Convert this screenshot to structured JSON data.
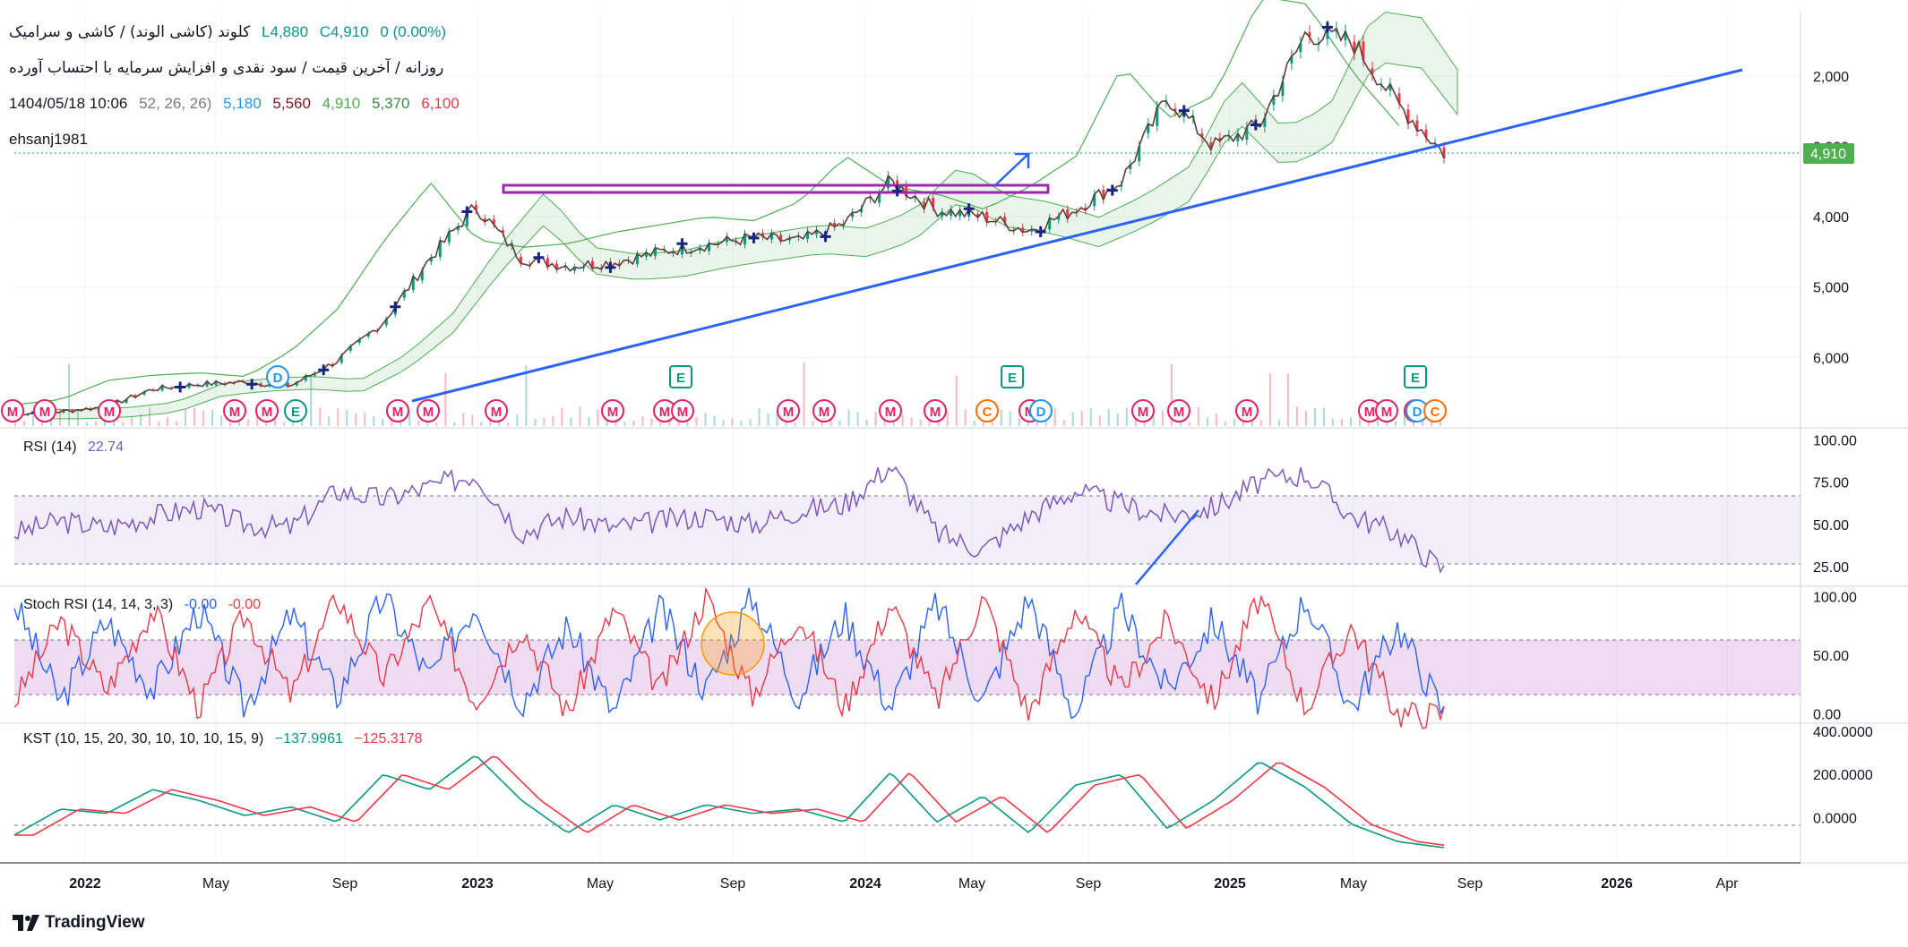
{
  "header": {
    "symbol_line": "کلوند (کاشی الوند) / کاشی و سرامیک",
    "ohlc_l": "L4,880",
    "ohlc_c": "C4,910",
    "change": "0 (0.00%)",
    "subtitle": "روزانه / آخرین قیمت / سود نقدی و افزایش سرمایه با احتساب آورده",
    "datetime": "1404/05/18 10:06",
    "author": "ehsanj1981",
    "ichimoku_params": "52, 26, 26)",
    "ichimoku_values": [
      "5,180",
      "5,560",
      "4,910",
      "5,370",
      "6,100"
    ],
    "ichimoku_colors": [
      "#2196f3",
      "#801922",
      "#4caf50",
      "#388e3c",
      "#f23645"
    ]
  },
  "price_axis": {
    "ticks": [
      "6,000",
      "5,000",
      "4,000",
      "3,000",
      "2,000"
    ],
    "last_price": "4,910"
  },
  "time_axis": {
    "labels": [
      "2022",
      "May",
      "Sep",
      "2023",
      "May",
      "Sep",
      "2024",
      "May",
      "Sep",
      "2025",
      "May",
      "Sep",
      "2026",
      "Apr"
    ]
  },
  "events": {
    "markers": [
      "M",
      "M",
      "M",
      "M",
      "M",
      "E",
      "M",
      "M",
      "M",
      "M",
      "M",
      "M",
      "M",
      "M",
      "M",
      "M",
      "C",
      "M",
      "D",
      "M",
      "M",
      "M",
      "M",
      "M",
      "M",
      "D",
      "C"
    ],
    "top_markers": [
      "D",
      "E",
      "E",
      "E"
    ]
  },
  "rsi": {
    "title": "RSI (14)",
    "value": "22.74",
    "ticks": [
      "100.00",
      "75.00",
      "50.00",
      "25.00"
    ]
  },
  "stoch": {
    "title": "Stoch RSI (14, 14, 3, 3)",
    "k": "-0.00",
    "d": "-0.00",
    "ticks": [
      "100.00",
      "50.00",
      "0.00"
    ]
  },
  "kst": {
    "title": "KST (10, 15, 20, 30, 10, 10, 10, 15, 9)",
    "v1": "−137.9961",
    "v2": "−125.3178",
    "ticks": [
      "400.0000",
      "200.0000",
      "0.0000"
    ]
  },
  "brand": "TradingView",
  "colors": {
    "up": "#089981",
    "down": "#f23645",
    "trend": "#2962ff",
    "rsi": "#7e57c2",
    "box": "#9c27b0"
  },
  "chart_data": [
    {
      "type": "line",
      "x": [
        "2021-12",
        "2022-01",
        "2022-03",
        "2022-05",
        "2022-07",
        "2022-09",
        "2022-11",
        "2022-12",
        "2023-02",
        "2023-04",
        "2023-05",
        "2023-06",
        "2023-08",
        "2023-10",
        "2023-12",
        "2024-02",
        "2024-04",
        "2024-06",
        "2024-07",
        "2024-08",
        "2024-09",
        "2024-10",
        "2024-11",
        "2024-12",
        "2025-01",
        "2025-02",
        "2025-03",
        "2025-04",
        "2025-05",
        "2025-06",
        "2025-07",
        "2025-08"
      ],
      "series": [
        {
          "values": [
            1200,
            1230,
            1300,
            1550,
            1620,
            1650,
            1600,
            1950,
            2500,
            3400,
            4150,
            3400,
            3300,
            3350,
            3500,
            3600,
            3700,
            3650,
            3900,
            4500,
            4100,
            4000,
            3800,
            4100,
            4500,
            5700,
            5000,
            5300,
            6600,
            6500,
            5600,
            4900
          ]
        }
      ],
      "ylim": [
        1000,
        6900
      ],
      "yticks": [
        2000,
        3000,
        4000,
        5000,
        6000
      ],
      "last_price": 4910
    },
    {
      "type": "line",
      "series": [
        {
          "values": [
            45,
            52,
            48,
            55,
            60,
            50,
            48,
            70,
            65,
            72,
            80,
            45,
            55,
            48,
            52,
            55,
            50,
            58,
            62,
            85,
            45,
            35,
            55,
            70,
            62,
            55,
            60,
            75,
            80,
            55,
            45,
            22.74
          ]
        }
      ],
      "ylim": [
        15,
        105
      ],
      "bands": [
        30,
        70
      ]
    },
    {
      "type": "line",
      "series": [
        {
          "values": [
            95,
            10,
            80,
            20,
            90,
            5,
            85,
            15,
            100,
            30,
            95,
            10,
            75,
            0,
            90,
            20,
            100,
            15,
            85,
            5,
            95,
            10,
            100,
            0,
            90,
            20,
            80,
            10,
            100,
            5,
            75,
            0
          ]
        }
      ],
      "ylim": [
        -5,
        105
      ],
      "bands": [
        20,
        80
      ]
    },
    {
      "type": "line",
      "series": [
        {
          "values": [
            -80,
            40,
            20,
            130,
            80,
            10,
            50,
            -20,
            200,
            130,
            290,
            80,
            -70,
            60,
            -10,
            60,
            20,
            40,
            -20,
            210,
            -20,
            100,
            -70,
            150,
            200,
            -50,
            80,
            260,
            140,
            -30,
            -110,
            -137.9961
          ]
        }
      ],
      "ylim": [
        -200,
        420
      ]
    }
  ]
}
